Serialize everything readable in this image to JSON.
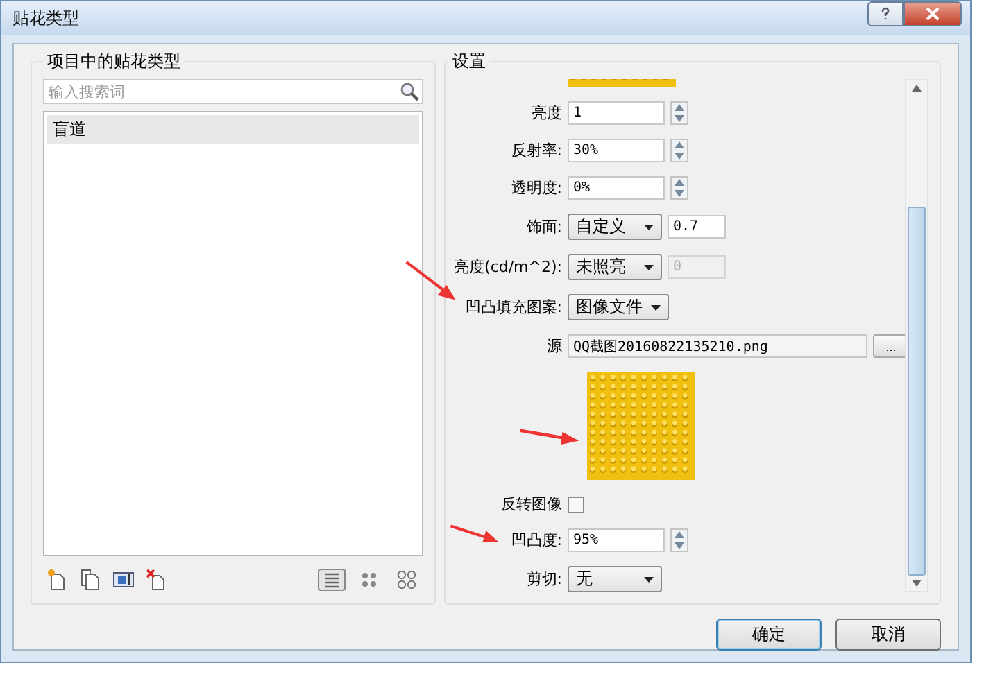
{
  "window": {
    "title": "贴花类型"
  },
  "left_panel": {
    "title": "项目中的贴花类型",
    "search": {
      "placeholder": "输入搜索词"
    },
    "items": [
      {
        "label": "盲道",
        "selected": true
      }
    ],
    "view_modes": [
      {
        "selected": true
      },
      {
        "selected": false
      },
      {
        "selected": false
      }
    ]
  },
  "right_panel": {
    "title": "设置",
    "rows": [
      {
        "kind": "picture_strip"
      },
      {
        "kind": "spinner",
        "label": "亮度",
        "value": "1"
      },
      {
        "kind": "spinner",
        "label": "反射率:",
        "value": "30%"
      },
      {
        "kind": "spinner",
        "label": "透明度:",
        "value": "0%"
      },
      {
        "kind": "dropdown_input",
        "label": "饰面:",
        "option": "自定义",
        "value": "0.7",
        "disabled": false
      },
      {
        "kind": "dropdown_input",
        "label": "亮度(cd/m^2):",
        "option": "未照亮",
        "value": "0",
        "disabled": true
      },
      {
        "kind": "dropdown",
        "label": "凹凸填充图案:",
        "option": "图像文件"
      },
      {
        "kind": "file",
        "label": "源",
        "value": "QQ截图20160822135210.png",
        "button": "..."
      },
      {
        "kind": "picture"
      },
      {
        "kind": "checkbox",
        "label": "反转图像",
        "checked": false
      },
      {
        "kind": "spinner",
        "label": "凹凸度:",
        "value": "95%"
      },
      {
        "kind": "dropdown",
        "label": "剪切:",
        "option": "无"
      }
    ]
  },
  "buttons": [
    {
      "label": "确定",
      "default": true
    },
    {
      "label": "取消",
      "default": false
    }
  ]
}
